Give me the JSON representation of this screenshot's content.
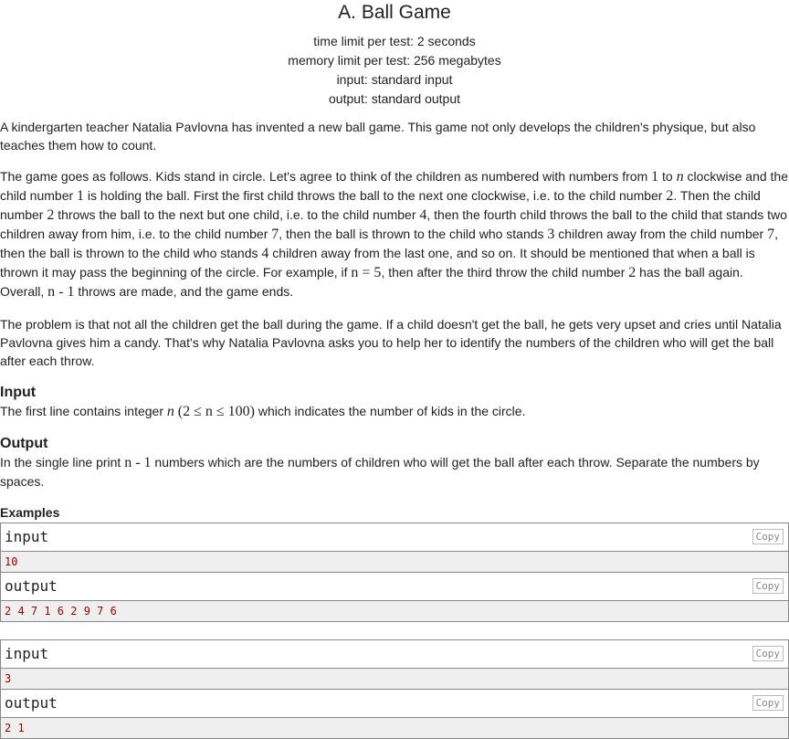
{
  "problem": {
    "title": "A. Ball Game",
    "limits": {
      "time": "time limit per test: 2 seconds",
      "memory": "memory limit per test: 256 megabytes",
      "input": "input: standard input",
      "output": "output: standard output"
    },
    "legend": {
      "p1": "A kindergarten teacher Natalia Pavlovna has invented a new ball game. This game not only develops the children's physique, but also teaches them how to count.",
      "p2": {
        "t1": "The game goes as follows. Kids stand in circle. Let's agree to think of the children as numbered with numbers from ",
        "m1": "1",
        "t2": " to ",
        "m2": "n",
        "t3": " clockwise and the child number ",
        "m3": "1",
        "t4": " is holding the ball. First the first child throws the ball to the next one clockwise, i.e. to the child number ",
        "m4": "2",
        "t5": ". Then the child number ",
        "m5": "2",
        "t6": " throws the ball to the next but one child, i.e. to the child number ",
        "m6": "4",
        "t7": ", then the fourth child throws the ball to the child that stands two children away from him, i.e. to the child number ",
        "m7": "7",
        "t8": ", then the ball is thrown to the child who stands ",
        "m8": "3",
        "t9": " children away from the child number ",
        "m9": "7",
        "t10": ", then the ball is thrown to the child who stands ",
        "m10": "4",
        "t11": " children away from the last one, and so on. It should be mentioned that when a ball is thrown it may pass the beginning of the circle. For example, if ",
        "m11": "n = 5",
        "t12": ", then after the third throw the child number ",
        "m12": "2",
        "t13": " has the ball again. Overall, ",
        "m13": "n - 1",
        "t14": " throws are made, and the game ends."
      },
      "p3": "The problem is that not all the children get the ball during the game. If a child doesn't get the ball, he gets very upset and cries until Natalia Pavlovna gives him a candy. That's why Natalia Pavlovna asks you to help her to identify the numbers of the children who will get the ball after each throw."
    },
    "input_spec": {
      "title": "Input",
      "t1": "The first line contains integer ",
      "m1": "n",
      "m2": "(2 ≤ n ≤ 100)",
      "t2": " which indicates the number of kids in the circle."
    },
    "output_spec": {
      "title": "Output",
      "t1": "In the single line print ",
      "m1": "n - 1",
      "t2": " numbers which are the numbers of children who will get the ball after each throw. Separate the numbers by spaces."
    },
    "examples": {
      "title": "Examples",
      "input_label": "input",
      "output_label": "output",
      "copy_label": "Copy",
      "items": [
        {
          "input": "10",
          "output": "2 4 7 1 6 2 9 7 6"
        },
        {
          "input": "3",
          "output": "2 1"
        }
      ]
    }
  }
}
